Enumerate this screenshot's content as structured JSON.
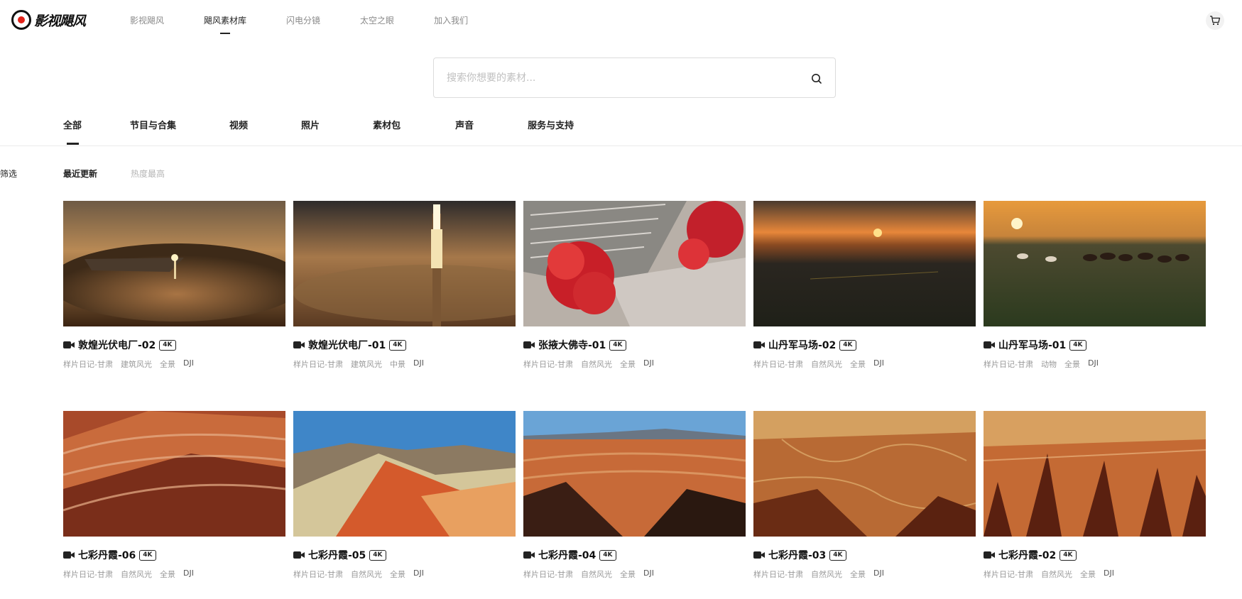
{
  "header": {
    "logo_text": "影视飓风",
    "nav": [
      {
        "label": "影视飓风",
        "active": false
      },
      {
        "label": "飓风素材库",
        "active": true
      },
      {
        "label": "闪电分镜",
        "active": false
      },
      {
        "label": "太空之眼",
        "active": false
      },
      {
        "label": "加入我们",
        "active": false
      }
    ],
    "cart_icon": "cart-icon"
  },
  "search": {
    "placeholder": "搜索你想要的素材...",
    "value": "",
    "icon": "search-icon"
  },
  "tabs": [
    {
      "label": "全部",
      "active": true
    },
    {
      "label": "节目与合集",
      "active": false
    },
    {
      "label": "视频",
      "active": false
    },
    {
      "label": "照片",
      "active": false
    },
    {
      "label": "素材包",
      "active": false
    },
    {
      "label": "声音",
      "active": false
    },
    {
      "label": "服务与支持",
      "active": false
    }
  ],
  "filter": {
    "label": "筛选",
    "sort": [
      {
        "label": "最近更新",
        "active": true
      },
      {
        "label": "热度最高",
        "active": false
      }
    ]
  },
  "cards": [
    {
      "title": "敦煌光伏电厂-02",
      "badge": "4K",
      "tags": [
        "样片日记-甘肃",
        "建筑风光",
        "全景",
        "DJI"
      ],
      "scene": "solar-wide"
    },
    {
      "title": "敦煌光伏电厂-01",
      "badge": "4K",
      "tags": [
        "样片日记-甘肃",
        "建筑风光",
        "中景",
        "DJI"
      ],
      "scene": "solar-tower"
    },
    {
      "title": "张掖大佛寺-01",
      "badge": "4K",
      "tags": [
        "样片日记-甘肃",
        "自然风光",
        "全景",
        "DJI"
      ],
      "scene": "temple"
    },
    {
      "title": "山丹军马场-02",
      "badge": "4K",
      "tags": [
        "样片日记-甘肃",
        "自然风光",
        "全景",
        "DJI"
      ],
      "scene": "sunset-plain"
    },
    {
      "title": "山丹军马场-01",
      "badge": "4K",
      "tags": [
        "样片日记-甘肃",
        "动物",
        "全景",
        "DJI"
      ],
      "scene": "horses"
    },
    {
      "title": "七彩丹霞-06",
      "badge": "4K",
      "tags": [
        "样片日记-甘肃",
        "自然风光",
        "全景",
        "DJI"
      ],
      "scene": "danxia-a"
    },
    {
      "title": "七彩丹霞-05",
      "badge": "4K",
      "tags": [
        "样片日记-甘肃",
        "自然风光",
        "全景",
        "DJI"
      ],
      "scene": "danxia-sky"
    },
    {
      "title": "七彩丹霞-04",
      "badge": "4K",
      "tags": [
        "样片日记-甘肃",
        "自然风光",
        "全景",
        "DJI"
      ],
      "scene": "danxia-valley"
    },
    {
      "title": "七彩丹霞-03",
      "badge": "4K",
      "tags": [
        "样片日记-甘肃",
        "自然风光",
        "全景",
        "DJI"
      ],
      "scene": "danxia-canyon"
    },
    {
      "title": "七彩丹霞-02",
      "badge": "4K",
      "tags": [
        "样片日记-甘肃",
        "自然风光",
        "全景",
        "DJI"
      ],
      "scene": "danxia-ridges"
    }
  ],
  "colors": {
    "accent": "#e2231a",
    "text": "#222222",
    "muted": "#999999"
  }
}
